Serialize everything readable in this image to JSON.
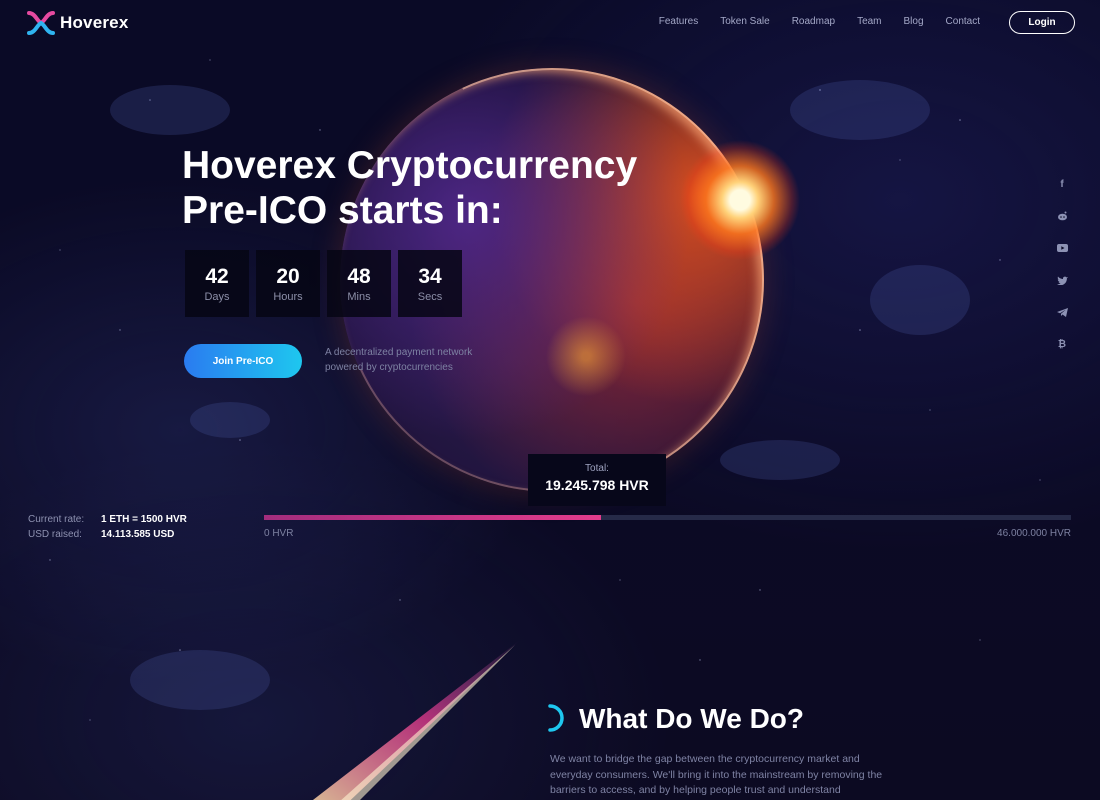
{
  "header": {
    "logo_text": "Hoverex",
    "nav": [
      "Features",
      "Token Sale",
      "Roadmap",
      "Team",
      "Blog",
      "Contact"
    ],
    "login_label": "Login"
  },
  "hero": {
    "title_line1": "Hoverex Cryptocurrency",
    "title_line2": "Pre-ICO starts in:",
    "countdown": [
      {
        "value": "42",
        "label": "Days"
      },
      {
        "value": "20",
        "label": "Hours"
      },
      {
        "value": "48",
        "label": "Mins"
      },
      {
        "value": "34",
        "label": "Secs"
      }
    ],
    "cta_label": "Join Pre-ICO",
    "tagline_line1": "A decentralized payment network",
    "tagline_line2": "powered by cryptocurrencies"
  },
  "social": [
    "facebook-icon",
    "reddit-icon",
    "youtube-icon",
    "twitter-icon",
    "telegram-icon",
    "bitcoin-icon"
  ],
  "sale": {
    "total_label": "Total:",
    "total_value": "19.245.798 HVR",
    "rate_label": "Current rate:",
    "rate_value": "1 ETH = 1500 HVR",
    "raised_label": "USD raised:",
    "raised_value": "14.113.585 USD",
    "progress_fraction": 0.418,
    "progress_min": "0 HVR",
    "progress_max": "46.000.000 HVR"
  },
  "what_we_do": {
    "title": "What Do We Do?",
    "text": "We want to bridge the gap between the cryptocurrency market and everyday consumers. We'll bring it into the mainstream by removing the barriers to access, and by helping people trust and understand"
  },
  "colors": {
    "background": "#0b0a25",
    "accent_blue": "#1ec7ef",
    "accent_pink": "#e23c8c"
  }
}
